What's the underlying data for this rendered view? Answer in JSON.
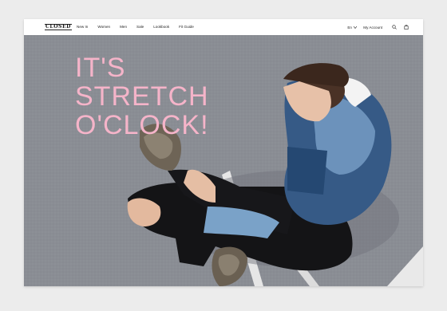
{
  "nav": {
    "logo": "CLOSED",
    "items": [
      "New In",
      "Women",
      "Men",
      "Sale",
      "Lookbook",
      "Fit Guide"
    ],
    "language": "En",
    "account": "My Account",
    "icons": [
      "search-icon",
      "bag-icon"
    ]
  },
  "hero": {
    "headline_lines": [
      "IT'S",
      "STRETCH",
      "O'CLOCK!"
    ]
  },
  "colors": {
    "headline": "#f5b4c9",
    "carpet": "#888b92"
  }
}
